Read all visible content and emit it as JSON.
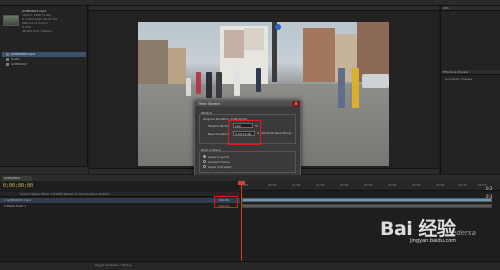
{
  "project": {
    "item_name": "GOPR0003.mp4",
    "info_lines": [
      "1920 x 1080 (1.00)",
      "Δ 0;00;10;00, 29.97 fps",
      "Millions of Colors",
      "H.264",
      "48.000 kHz / Stereo"
    ],
    "items": [
      "GOPR0003.mp4",
      "Solids",
      "GOPR0003"
    ]
  },
  "dialog": {
    "title": "Time Stretch",
    "section_stretch": "Stretch",
    "original_duration_label": "Original Duration: 0;00;10;00",
    "stretch_factor_label": "Stretch Factor:",
    "stretch_factor_value": "100",
    "stretch_factor_unit": "%",
    "new_duration_label": "New Duration:",
    "new_duration_value": "0;00;10;00",
    "new_duration_suffix": "is 0;00;10;00 Base 30drop",
    "section_hold": "Hold in Place",
    "hold_options": [
      "Layer In-point",
      "Current Frame",
      "Layer Out-point"
    ],
    "ok_label": "OK",
    "cancel_label": "Cancel"
  },
  "right_panel": {
    "tab_label": "Info",
    "second_tab_label": "Effects & Presets",
    "preset_label": "Animation Presets"
  },
  "timeline": {
    "tab_label": "GOPR0003",
    "timecode": "0;00;00;00",
    "columns": "Source Name  Mode  T  TrkMat  Parent  In  Out  Duration  Stretch",
    "layers": [
      {
        "label": "1  GOPR0003.mp4",
        "stretch": "100.0%"
      },
      {
        "label": "2  Black Solid 1",
        "stretch": "100.0%"
      }
    ],
    "ticks": [
      "00f",
      "00:15f",
      "01:00f",
      "01:15f",
      "02:00f",
      "02:15f",
      "03:00f",
      "03:15f",
      "04:00f",
      "04:15f",
      "05:00f"
    ],
    "bottom_label": "Toggle Switches / Modes",
    "side_timecodes": [
      "0:2",
      "0:3"
    ]
  },
  "watermark": {
    "main": "Bai 经验",
    "sub": "jingyan.baidu.com",
    "brand": "edersa"
  },
  "colors": {
    "highlight_box": "#e0191c",
    "layer_bar": "#7393a8",
    "playhead": "#d43a2a",
    "timecode": "#d7b74a"
  }
}
